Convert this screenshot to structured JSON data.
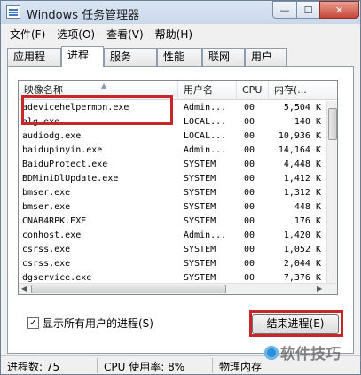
{
  "window": {
    "title": "Windows 任务管理器"
  },
  "title_buttons": {
    "minimize": "—",
    "maximize": "☐",
    "close": "✕"
  },
  "menu": [
    "文件(F)",
    "选项(O)",
    "查看(V)",
    "帮助(H)"
  ],
  "tabs": [
    {
      "label": "应用程序",
      "active": false
    },
    {
      "label": "进程",
      "active": true
    },
    {
      "label": "服务",
      "active": false
    },
    {
      "label": "性能",
      "active": false
    },
    {
      "label": "联网",
      "active": false
    },
    {
      "label": "用户",
      "active": false
    }
  ],
  "columns": [
    "映像名称",
    "用户名",
    "CPU",
    "内存(..."
  ],
  "processes": [
    {
      "name": "adevicehelpermon.exe",
      "user": "Admin...",
      "cpu": "00",
      "mem": "5,504 K"
    },
    {
      "name": "alg.exe",
      "user": "LOCAL...",
      "cpu": "00",
      "mem": "140 K"
    },
    {
      "name": "audiodg.exe",
      "user": "LOCAL...",
      "cpu": "00",
      "mem": "10,936 K"
    },
    {
      "name": "baidupinyin.exe",
      "user": "Admin...",
      "cpu": "00",
      "mem": "14,164 K"
    },
    {
      "name": "BaiduProtect.exe",
      "user": "SYSTEM",
      "cpu": "00",
      "mem": "4,448 K"
    },
    {
      "name": "BDMiniDlUpdate.exe",
      "user": "SYSTEM",
      "cpu": "00",
      "mem": "1,412 K"
    },
    {
      "name": "bmser.exe",
      "user": "SYSTEM",
      "cpu": "00",
      "mem": "1,312 K"
    },
    {
      "name": "bmser.exe",
      "user": "SYSTEM",
      "cpu": "00",
      "mem": "448 K"
    },
    {
      "name": "CNAB4RPK.EXE",
      "user": "SYSTEM",
      "cpu": "00",
      "mem": "176 K"
    },
    {
      "name": "conhost.exe",
      "user": "Admin...",
      "cpu": "00",
      "mem": "1,420 K"
    },
    {
      "name": "csrss.exe",
      "user": "SYSTEM",
      "cpu": "00",
      "mem": "1,052 K"
    },
    {
      "name": "csrss.exe",
      "user": "SYSTEM",
      "cpu": "00",
      "mem": "2,044 K"
    },
    {
      "name": "dgservice.exe",
      "user": "SYSTEM",
      "cpu": "00",
      "mem": "7,376 K"
    }
  ],
  "show_all_users": {
    "label": "显示所有用户的进程(S)",
    "checked": true,
    "check_mark": "✓"
  },
  "end_process_button": "结束进程(E)",
  "status": {
    "processes": "进程数: 75",
    "cpu": "CPU 使用率: 8%",
    "memory": "物理内存"
  },
  "scroll_arrows": {
    "left": "◀",
    "right": "▶",
    "sort": "▲"
  },
  "watermark": {
    "text": "软件技巧"
  },
  "colors": {
    "highlight": "#c7262a",
    "title_gradient": "#dbe6f3",
    "close": "#c8453a"
  }
}
